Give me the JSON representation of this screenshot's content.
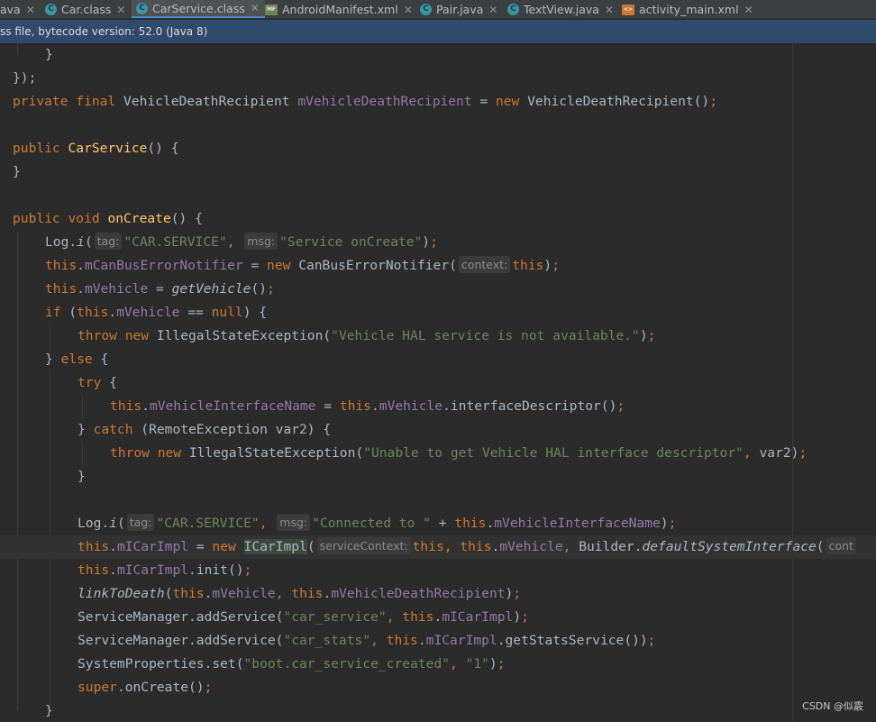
{
  "tabs": [
    {
      "label": "ava",
      "icon": "none",
      "active": false
    },
    {
      "label": "Car.class",
      "icon": "class-file-icon",
      "active": false
    },
    {
      "label": "CarService.class",
      "icon": "class-file-icon",
      "active": true
    },
    {
      "label": "AndroidManifest.xml",
      "icon": "manifest-file-icon",
      "active": false
    },
    {
      "label": "Pair.java",
      "icon": "class-file-icon",
      "active": false
    },
    {
      "label": "TextView.java",
      "icon": "class-file-icon",
      "active": false
    },
    {
      "label": "activity_main.xml",
      "icon": "layout-file-icon",
      "active": false
    }
  ],
  "infobar": {
    "text": "ss file, bytecode version: 52.0 (Java 8)"
  },
  "code": {
    "l1": "}",
    "l2": "});",
    "l3_kw": "private final",
    "l3_type": " VehicleDeathRecipient ",
    "l3_field": "mVehicleDeathRecipient",
    "l3_eq": " = ",
    "l3_new": "new",
    "l3_rest": " VehicleDeathRecipient()",
    "l3_semi": ";",
    "l5_kw": "public",
    "l5_name": "CarService",
    "l5_rest": "() {",
    "l6": "}",
    "l8_kw": "public void",
    "l8_name": "onCreate",
    "l8_rest": "() {",
    "l9_a": "Log.",
    "l9_fn": "i",
    "l9_b": "(",
    "l9_hint1": "tag:",
    "l9_s1": "\"CAR.SERVICE\"",
    "l9_c": ",",
    "l9_hint2": "msg:",
    "l9_s2": "\"Service onCreate\"",
    "l9_d": ")",
    "l9_semi": ";",
    "l10_this": "this",
    "l10_dot": ".",
    "l10_field": "mCanBusErrorNotifier",
    "l10_eq": " = ",
    "l10_new": "new",
    "l10_type": " CanBusErrorNotifier(",
    "l10_hint": "context:",
    "l10_this2": "this",
    "l10_end": ")",
    "l10_semi": ";",
    "l11_this": "this",
    "l11_dot": ".",
    "l11_field": "mVehicle",
    "l11_eq": " = ",
    "l11_fn": "getVehicle",
    "l11_end": "()",
    "l11_semi": ";",
    "l12_if": "if",
    "l12_a": " (",
    "l12_this": "this",
    "l12_dot": ".",
    "l12_field": "mVehicle",
    "l12_eq": " == ",
    "l12_null": "null",
    "l12_end": ") {",
    "l13_kw": "throw new",
    "l13_type": " IllegalStateException(",
    "l13_str": "\"Vehicle HAL service is not available.\"",
    "l13_end": ")",
    "l13_semi": ";",
    "l14_a": "} ",
    "l14_kw": "else",
    "l14_b": " {",
    "l15_kw": "try",
    "l15_b": " {",
    "l16_this": "this",
    "l16_dot": ".",
    "l16_field": "mVehicleInterfaceName",
    "l16_eq": " = ",
    "l16_this2": "this",
    "l16_dot2": ".",
    "l16_field2": "mVehicle",
    "l16_rest": ".interfaceDescriptor()",
    "l16_semi": ";",
    "l17_a": "} ",
    "l17_kw": "catch",
    "l17_b": " (RemoteException var2) {",
    "l18_kw": "throw new",
    "l18_type": " IllegalStateException(",
    "l18_str": "\"Unable to get Vehicle HAL interface descriptor\"",
    "l18_c": ",",
    "l18_rest": " var2)",
    "l18_semi": ";",
    "l19": "}",
    "l21_a": "Log.",
    "l21_fn": "i",
    "l21_b": "(",
    "l21_hint1": "tag:",
    "l21_s1": "\"CAR.SERVICE\"",
    "l21_c": ",",
    "l21_hint2": "msg:",
    "l21_s2": "\"Connected to \"",
    "l21_plus": " + ",
    "l21_this": "this",
    "l21_dot": ".",
    "l21_field": "mVehicleInterfaceName",
    "l21_end": ")",
    "l21_semi": ";",
    "l22_this": "this",
    "l22_dot": ".",
    "l22_field": "mICarImpl",
    "l22_eq": " = ",
    "l22_new": "new",
    "l22_sp": " ",
    "l22_type": "ICarImpl",
    "l22_paren": "(",
    "l22_hint": "serviceContext:",
    "l22_this2": "this",
    "l22_c1": ",",
    "l22_sp2": " ",
    "l22_this3": "this",
    "l22_dot3": ".",
    "l22_field3": "mVehicle",
    "l22_c2": ",",
    "l22_b": " Builder.",
    "l22_fn": "defaultSystemInterface",
    "l22_paren2": "(",
    "l22_hint2": "cont",
    "l23_this": "this",
    "l23_dot": ".",
    "l23_field": "mICarImpl",
    "l23_rest": ".init()",
    "l23_semi": ";",
    "l24_fn": "linkToDeath",
    "l24_a": "(",
    "l24_this": "this",
    "l24_dot": ".",
    "l24_field": "mVehicle",
    "l24_c": ",",
    "l24_sp": " ",
    "l24_this2": "this",
    "l24_dot2": ".",
    "l24_field2": "mVehicleDeathRecipient",
    "l24_end": ")",
    "l24_semi": ";",
    "l25_a": "ServiceManager.addService(",
    "l25_str": "\"car_service\"",
    "l25_c": ",",
    "l25_sp": " ",
    "l25_this": "this",
    "l25_dot": ".",
    "l25_field": "mICarImpl",
    "l25_end": ")",
    "l25_semi": ";",
    "l26_a": "ServiceManager.addService(",
    "l26_str": "\"car_stats\"",
    "l26_c": ",",
    "l26_sp": " ",
    "l26_this": "this",
    "l26_dot": ".",
    "l26_field": "mICarImpl",
    "l26_rest": ".getStatsService())",
    "l26_semi": ";",
    "l27_a": "SystemProperties.set(",
    "l27_str": "\"boot.car_service_created\"",
    "l27_c": ",",
    "l27_sp": " ",
    "l27_str2": "\"1\"",
    "l27_end": ")",
    "l27_semi": ";",
    "l28_kw": "super",
    "l28_rest": ".onCreate()",
    "l28_semi": ";",
    "l29": "}"
  },
  "watermark": "CSDN @似霰"
}
